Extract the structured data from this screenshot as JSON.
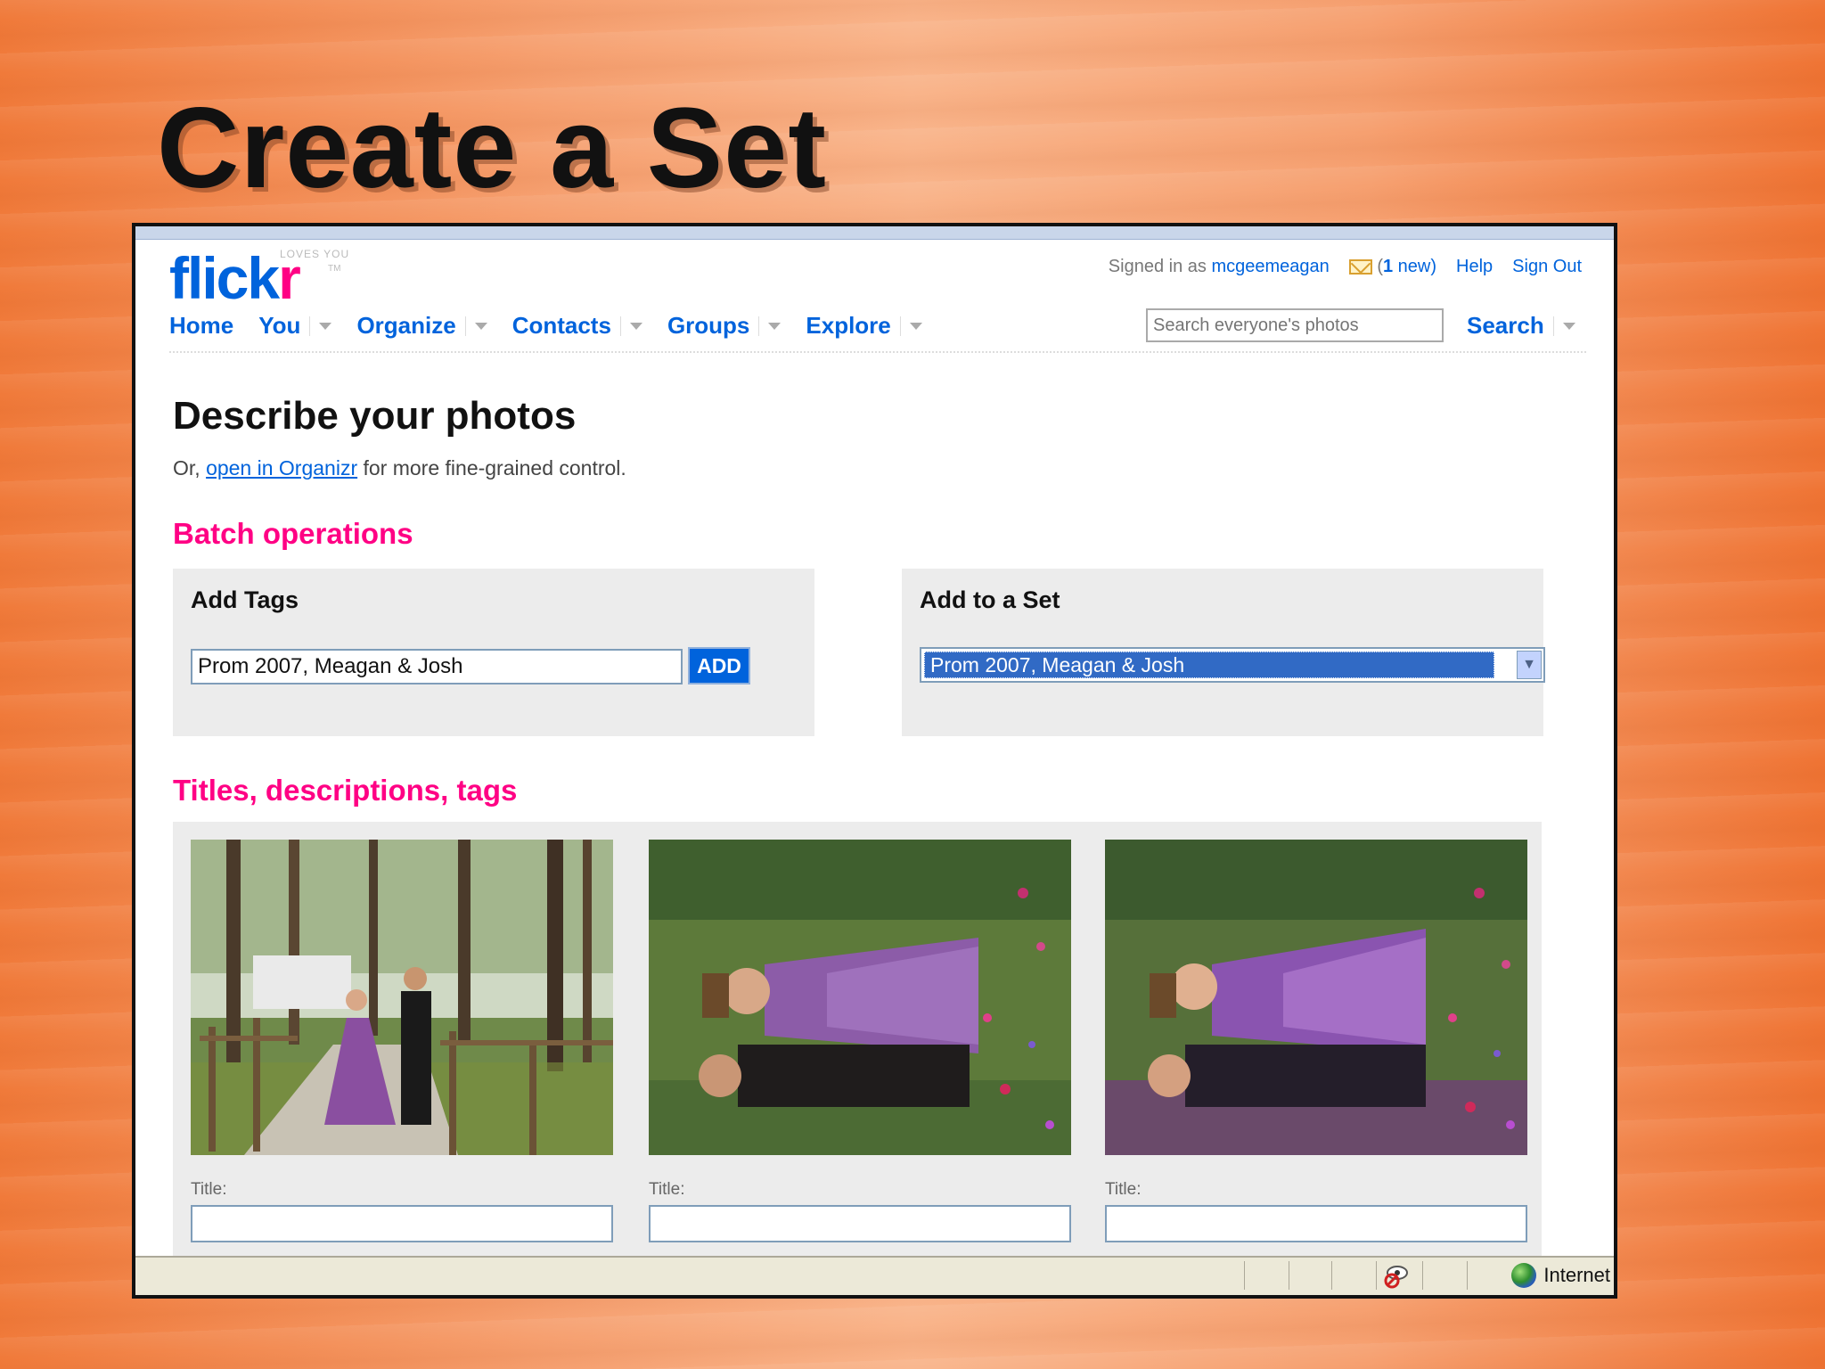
{
  "slide": {
    "title": "Create a Set"
  },
  "header": {
    "logo_main": "flick",
    "logo_accent": "r",
    "logo_tagline": "LOVES YOU",
    "logo_tm": "TM",
    "signed_in_prefix": "Signed in as",
    "username": "mcgeemeagan",
    "mail_paren_open": "(",
    "mail_count": "1",
    "mail_suffix": "new)",
    "help": "Help",
    "sign_out": "Sign Out"
  },
  "nav": {
    "items": [
      {
        "label": "Home"
      },
      {
        "label": "You"
      },
      {
        "label": "Organize"
      },
      {
        "label": "Contacts"
      },
      {
        "label": "Groups"
      },
      {
        "label": "Explore"
      }
    ],
    "search_placeholder": "Search everyone's photos",
    "search_label": "Search"
  },
  "main": {
    "heading": "Describe your photos",
    "sub_prefix": "Or,",
    "sub_link": "open in Organizr",
    "sub_suffix": "for more fine-grained control.",
    "batch_heading": "Batch operations",
    "add_tags": {
      "title": "Add Tags",
      "value": "Prom 2007, Meagan & Josh",
      "button": "ADD"
    },
    "add_to_set": {
      "title": "Add to a Set",
      "selected": "Prom 2007, Meagan & Josh"
    },
    "titles_heading": "Titles, descriptions, tags",
    "photos": [
      {
        "title_label": "Title:",
        "title_value": ""
      },
      {
        "title_label": "Title:",
        "title_value": ""
      },
      {
        "title_label": "Title:",
        "title_value": ""
      }
    ]
  },
  "statusbar": {
    "zone": "Internet"
  },
  "colors": {
    "flickr_blue": "#0063dc",
    "flickr_pink": "#ff0084"
  }
}
